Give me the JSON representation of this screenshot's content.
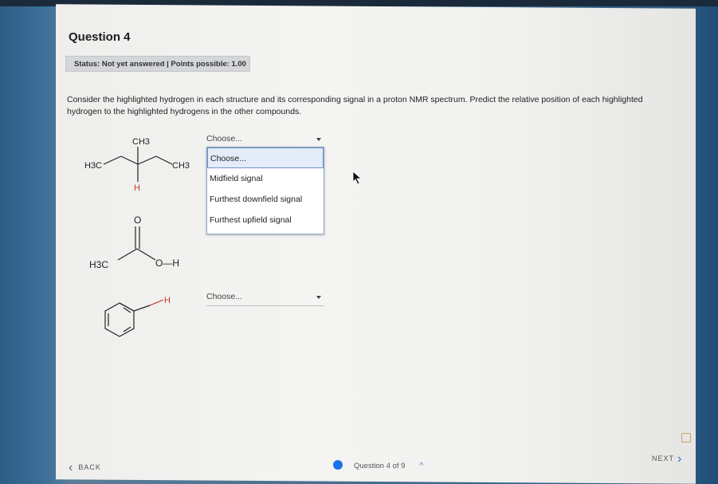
{
  "question": {
    "title": "Question 4",
    "status": "Status: Not yet answered | Points possible: 1.00",
    "prompt": "Consider the highlighted hydrogen in each structure and its corresponding signal in a proton NMR spectrum. Predict the relative position of each highlighted hydrogen to the highlighted hydrogens in the other compounds."
  },
  "structures": {
    "isobutane": {
      "ch3_top": "CH3",
      "h3c_left": "H3C",
      "ch3_right": "CH3",
      "h_bottom": "H"
    },
    "acetic_acid": {
      "o_top": "O",
      "h3c_left": "H3C",
      "oh": "O—H"
    },
    "benzaldehyde": {
      "h": "H"
    }
  },
  "selects": [
    {
      "value": "Choose..."
    },
    {
      "value": "Choose..."
    }
  ],
  "dropdown": {
    "options": [
      "Choose...",
      "Midfield signal",
      "Furthest downfield signal",
      "Furthest upfield signal"
    ],
    "highlighted": 0
  },
  "nav": {
    "back": "BACK",
    "progress": "Question 4 of 9",
    "next": "NEXT"
  },
  "colors": {
    "highlight_h": "#c0392b",
    "accent": "#1a73e8"
  }
}
